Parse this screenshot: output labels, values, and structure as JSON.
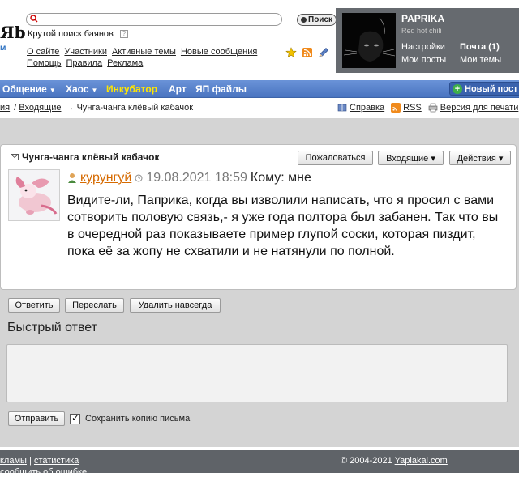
{
  "header": {
    "logo_text": "Яb",
    "logo_sub": "м",
    "search_placeholder": "",
    "search_button": "Поиск",
    "tagline": "Крутой поиск баянов",
    "tagline_help": "?",
    "nav_row1": [
      "О сайте",
      "Участники",
      "Активные темы",
      "Новые сообщения"
    ],
    "nav_row2": [
      "Помощь",
      "Правила",
      "Реклама"
    ],
    "icons": [
      "star-icon",
      "rss-icon",
      "pencil-icon"
    ]
  },
  "user": {
    "name": "PAPRIKA",
    "subtitle": "Red hot chili",
    "settings": "Настройки",
    "mail": "Почта (1)",
    "my_posts": "Мои посты",
    "my_topics": "Мои темы"
  },
  "topnav": {
    "items": [
      {
        "label": "Общение",
        "caret": "▼"
      },
      {
        "label": "Хаос",
        "caret": "▼"
      },
      {
        "label": "Инкубатор",
        "caret": ""
      },
      {
        "label": "Арт",
        "caret": ""
      },
      {
        "label": "ЯП файлы",
        "caret": ""
      }
    ],
    "new_post": "Новый пост",
    "new_post_plus": "+"
  },
  "breadcrumb": {
    "part0": "ия",
    "sep0": "/",
    "inbox": "Входящие",
    "arrow": "→",
    "current": "Чунга-чанга клёвый кабачок"
  },
  "tools": {
    "help": "Справка",
    "rss": "RSS",
    "print": "Версия для печати"
  },
  "message": {
    "title": "Чунга-чанга клёвый кабачок",
    "complain": "Пожаловаться",
    "inbox_dropdown": "Входящие ▾",
    "actions_dropdown": "Действия ▾",
    "author": "курунгуй",
    "date": "19.08.2021 18:59",
    "to": "Кому: мне",
    "body": "Видите-ли, Паприка, когда вы изволили написать, что я просил с вами сотворить половую связь,- я уже года полтора был забанен. Так что вы в очередной раз показываете пример глупой соски, которая пиздит, пока её за жопу не схватили и не натянули по полной."
  },
  "message_actions": {
    "reply": "Ответить",
    "forward": "Переслать",
    "delete": "Удалить навсегда"
  },
  "quick_reply": {
    "title": "Быстрый ответ",
    "send": "Отправить",
    "save_copy": "Сохранить копию письма"
  },
  "footer": {
    "ads": "кламы",
    "sep": "|",
    "stats": "статистика",
    "report": "сообщить об ошибке",
    "copyright": "© 2004-2021",
    "site": "Yaplakal.com"
  },
  "colors": {
    "nav_blue": "#4a74c0",
    "nav_highlight": "#ffe600",
    "author_orange": "#d66a00",
    "user_panel": "#666a6f"
  }
}
